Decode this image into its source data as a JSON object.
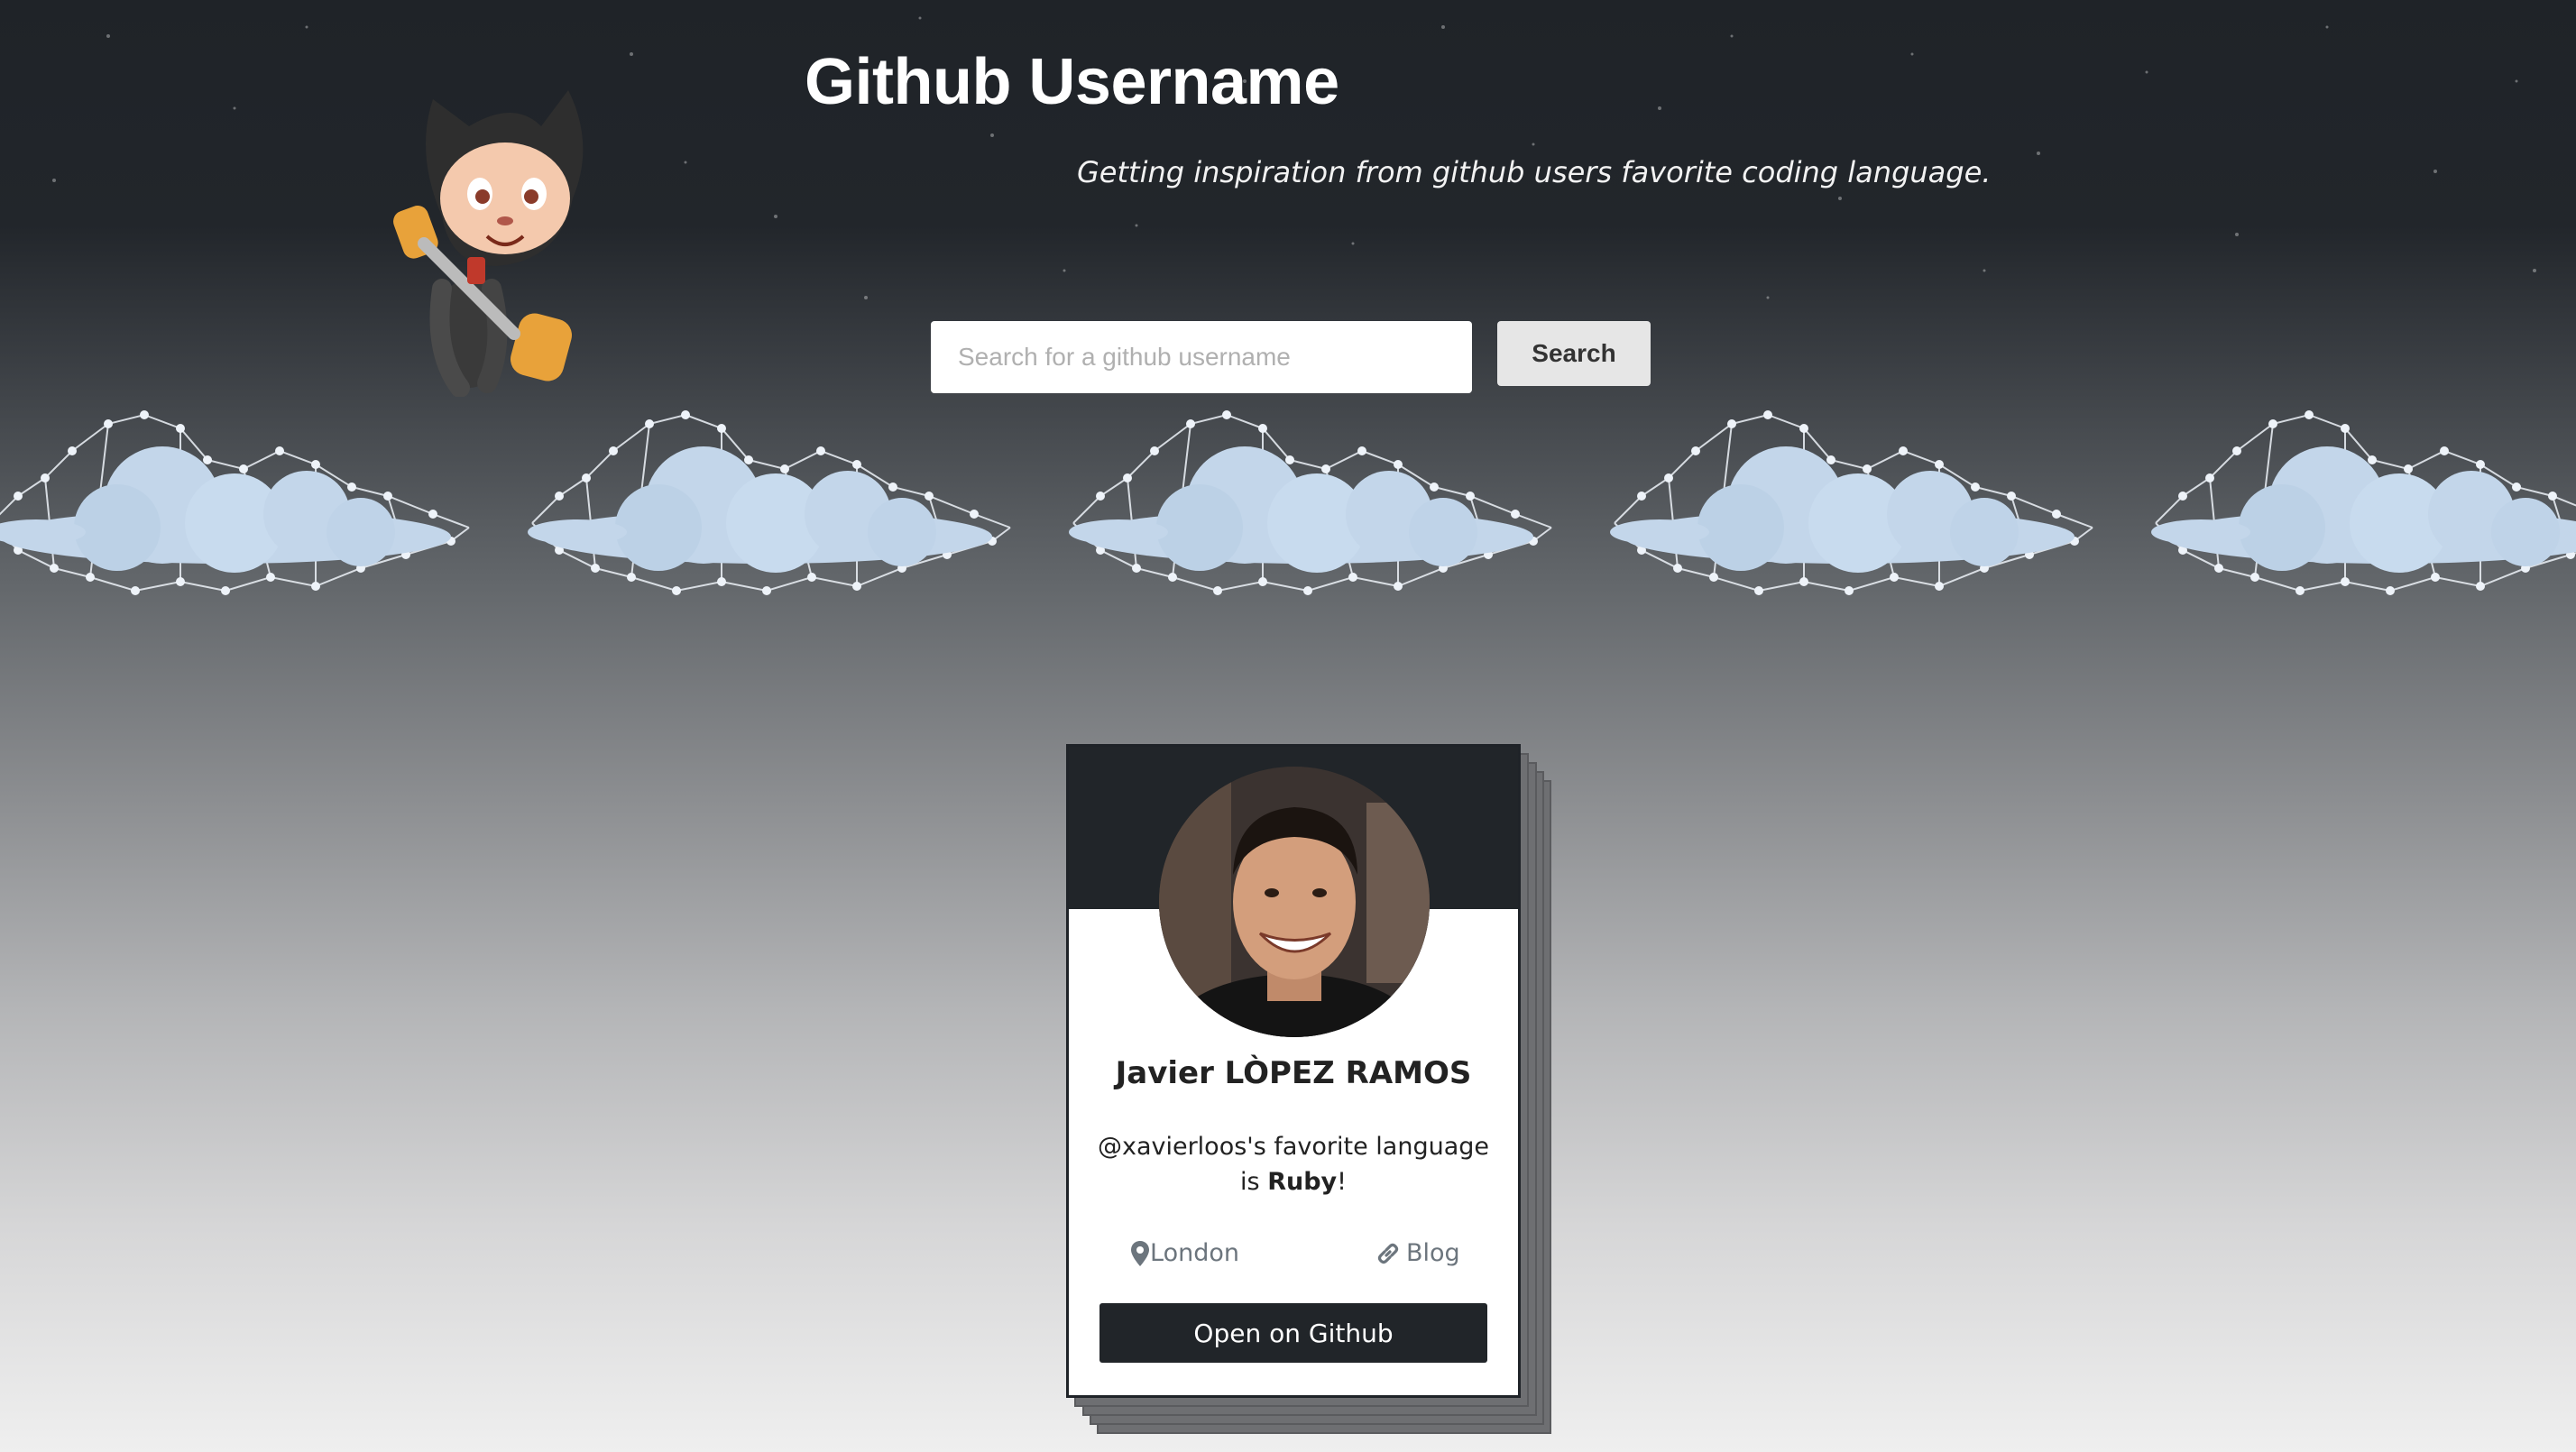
{
  "header": {
    "title": "Github Username",
    "subtitle": "Getting inspiration from github users favorite coding language."
  },
  "search": {
    "placeholder": "Search for a github username",
    "value": "",
    "button_label": "Search"
  },
  "profile_card": {
    "name": "Javier LÒPEZ RAMOS",
    "handle": "@xavierloos",
    "favorite_prefix": "'s favorite language is ",
    "language": "Ruby",
    "favorite_suffix": "!",
    "location": "London",
    "blog_label": "Blog",
    "open_button_label": "Open on Github"
  },
  "icons": {
    "mascot": "octocat-jetpack-icon",
    "location": "map-pin-icon",
    "blog": "link-icon"
  },
  "colors": {
    "header_dark": "#1f2328",
    "cloud": "#c3d6ea",
    "card_header": "#212529",
    "button": "#212529",
    "muted_text": "#6c757d"
  }
}
